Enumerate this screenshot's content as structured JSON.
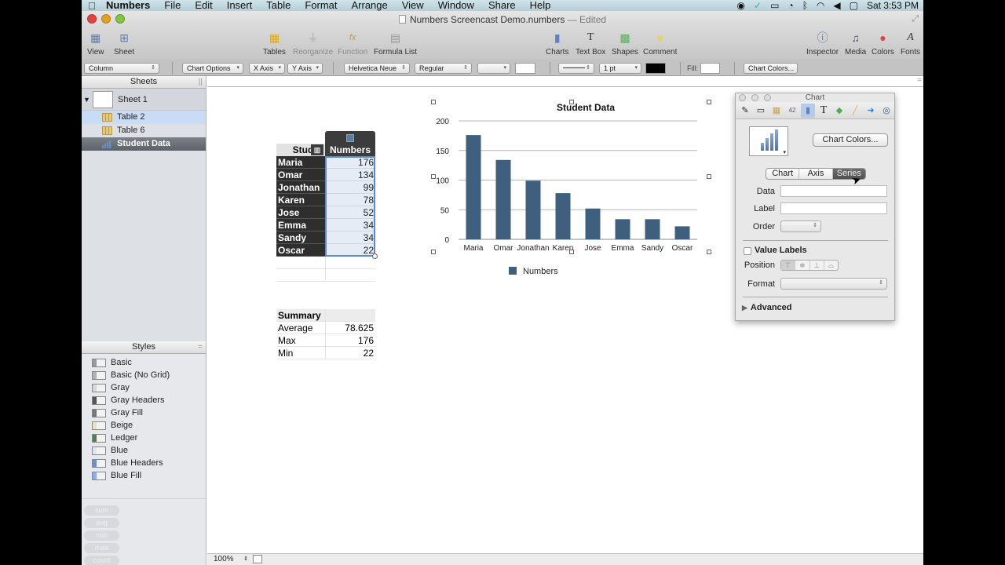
{
  "menubar": {
    "apple_icon": "",
    "items": [
      "Numbers",
      "File",
      "Edit",
      "Insert",
      "Table",
      "Format",
      "Arrange",
      "View",
      "Window",
      "Share",
      "Help"
    ],
    "clock": "Sat 3:53 PM",
    "status_icons": [
      "record-icon",
      "sync-icon",
      "airplay-icon",
      "time-machine-icon",
      "bluetooth-icon",
      "wifi-icon",
      "volume-icon",
      "activity-icon"
    ]
  },
  "window": {
    "title": "Numbers Screencast Demo.numbers",
    "edited": "— Edited"
  },
  "toolbar": {
    "view": "View",
    "sheet": "Sheet",
    "tables": "Tables",
    "reorganize": "Reorganize",
    "function": "Function",
    "formula_list": "Formula List",
    "charts": "Charts",
    "text_box": "Text Box",
    "shapes": "Shapes",
    "comment": "Comment",
    "inspector": "Inspector",
    "media": "Media",
    "colors": "Colors",
    "fonts": "Fonts"
  },
  "formatbar": {
    "chart_type": "Column",
    "chart_options": "Chart Options",
    "x_axis": "X Axis",
    "y_axis": "Y Axis",
    "font": "Helvetica Neue",
    "font_style": "Regular",
    "stroke_width": "1 pt",
    "fill_label": "Fill:",
    "chart_colors": "Chart Colors...",
    "stroke_color": "#000000"
  },
  "sidebar": {
    "sheets_header": "Sheets",
    "sheet_name": "Sheet 1",
    "items": [
      {
        "label": "Table 2",
        "type": "table",
        "state": "highlighted"
      },
      {
        "label": "Table 6",
        "type": "table",
        "state": "normal"
      },
      {
        "label": "Student Data",
        "type": "chart",
        "state": "selected"
      }
    ],
    "styles_header": "Styles",
    "styles": [
      {
        "label": "Basic",
        "swatch": "#9a9a9a"
      },
      {
        "label": "Basic (No Grid)",
        "swatch": "#b0b0b0"
      },
      {
        "label": "Gray",
        "swatch": "#d8d8d8"
      },
      {
        "label": "Gray Headers",
        "swatch": "#555555"
      },
      {
        "label": "Gray Fill",
        "swatch": "#777777"
      },
      {
        "label": "Beige",
        "swatch": "#e8e0c8"
      },
      {
        "label": "Ledger",
        "swatch": "#5a7a5a"
      },
      {
        "label": "Blue",
        "swatch": "#dfe6f2"
      },
      {
        "label": "Blue Headers",
        "swatch": "#6f8fc8"
      },
      {
        "label": "Blue Fill",
        "swatch": "#8faee0"
      }
    ],
    "functions": [
      "sum",
      "avg",
      "min",
      "max",
      "count"
    ]
  },
  "status": {
    "zoom": "100%"
  },
  "student_table": {
    "headers": [
      "Stude",
      "Numbers"
    ],
    "rows": [
      {
        "name": "Maria",
        "value": "176"
      },
      {
        "name": "Omar",
        "value": "134"
      },
      {
        "name": "Jonathan",
        "value": "99"
      },
      {
        "name": "Karen",
        "value": "78"
      },
      {
        "name": "Jose",
        "value": "52"
      },
      {
        "name": "Emma",
        "value": "34"
      },
      {
        "name": "Sandy",
        "value": "34"
      },
      {
        "name": "Oscar",
        "value": "22"
      }
    ]
  },
  "summary_table": {
    "title": "Summary",
    "rows": [
      {
        "label": "Average",
        "value": "78.625"
      },
      {
        "label": "Max",
        "value": "176"
      },
      {
        "label": "Min",
        "value": "22"
      }
    ]
  },
  "chart_data": {
    "type": "bar",
    "title": "Student Data",
    "categories": [
      "Maria",
      "Omar",
      "Jonathan",
      "Karen",
      "Jose",
      "Emma",
      "Sandy",
      "Oscar"
    ],
    "series": [
      {
        "name": "Numbers",
        "values": [
          176,
          134,
          99,
          78,
          52,
          34,
          34,
          22
        ],
        "color": "#3f5f7f"
      }
    ],
    "xlabel": "",
    "ylabel": "",
    "ylim": [
      0,
      200
    ],
    "yticks": [
      0,
      50,
      100,
      150,
      200
    ],
    "grid": true,
    "legend": "bottom-center"
  },
  "inspector": {
    "title": "Chart",
    "tabs": [
      "document-icon",
      "sheet-icon",
      "table-icon",
      "cells-icon",
      "chart-icon",
      "text-icon",
      "graphic-icon",
      "metrics-icon",
      "hyperlink-icon",
      "quicktime-icon"
    ],
    "chart_colors_btn": "Chart Colors...",
    "segments": [
      "Chart",
      "Axis",
      "Series"
    ],
    "active_segment": "Series",
    "data_label": "Data",
    "label_label": "Label",
    "order_label": "Order",
    "value_labels": "Value Labels",
    "position_label": "Position",
    "format_label": "Format",
    "advanced": "Advanced",
    "position_options": [
      "⊤",
      "≑",
      "⊥",
      "⌓"
    ]
  }
}
